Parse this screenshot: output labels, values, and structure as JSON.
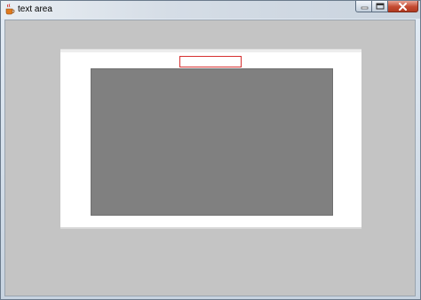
{
  "window": {
    "title": "text area"
  },
  "icons": {
    "app": "java-coffee-cup-icon",
    "minimize": "minimize-icon",
    "maximize": "maximize-icon",
    "close": "close-icon"
  },
  "form": {
    "text_field_value": "",
    "text_area_value": ""
  },
  "colors": {
    "content_background": "#c4c4c4",
    "panel_background": "#ffffff",
    "text_area_background": "#808080",
    "text_field_border": "#d63030",
    "close_button": "#c34a31"
  }
}
